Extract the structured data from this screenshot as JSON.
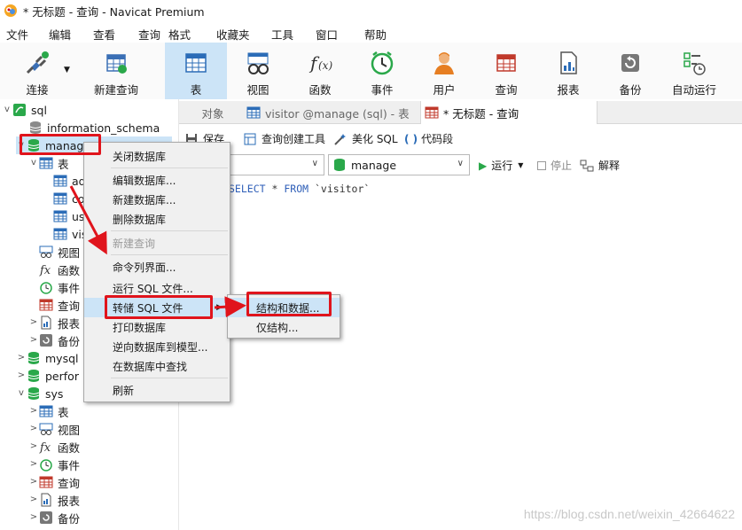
{
  "window": {
    "title": "* 无标题 - 查询 - Navicat Premium"
  },
  "menubar": [
    "文件",
    "编辑",
    "查看",
    "查询",
    "格式",
    "收藏夹",
    "工具",
    "窗口",
    "帮助"
  ],
  "toolbar": {
    "items": [
      {
        "label": "连接",
        "icon": "plug-icon"
      },
      {
        "label": "新建查询",
        "icon": "new-query-icon"
      },
      {
        "label": "表",
        "icon": "table-icon"
      },
      {
        "label": "视图",
        "icon": "view-glasses-icon"
      },
      {
        "label": "函数",
        "icon": "function-icon"
      },
      {
        "label": "事件",
        "icon": "clock-icon"
      },
      {
        "label": "用户",
        "icon": "user-icon"
      },
      {
        "label": "查询",
        "icon": "query-icon"
      },
      {
        "label": "报表",
        "icon": "report-icon"
      },
      {
        "label": "备份",
        "icon": "backup-icon"
      },
      {
        "label": "自动运行",
        "icon": "schedule-icon"
      }
    ]
  },
  "tree": {
    "connection": "sql",
    "info_schema": "information_schema",
    "manage": "manag",
    "manage_table_folder": "表",
    "manage_tables": [
      "ad",
      "co",
      "us",
      "vis"
    ],
    "manage_view": "视图",
    "manage_func": "函数",
    "manage_event": "事件",
    "manage_query": "查询",
    "manage_report": "报表",
    "manage_backup": "备份",
    "mysql": "mysql",
    "perf": "perfor",
    "sys": "sys",
    "sys_items": [
      "表",
      "视图",
      "函数",
      "事件",
      "查询",
      "报表",
      "备份"
    ]
  },
  "tabs": {
    "objects": "对象",
    "visitor": "visitor @manage (sql) - 表",
    "query": "* 无标题 - 查询"
  },
  "querybar": {
    "save": "保存",
    "builder": "查询创建工具",
    "beautify": "美化 SQL",
    "snippet": "代码段",
    "database": "manage",
    "run": "运行",
    "stop": "停止",
    "explain": "解释"
  },
  "editor": {
    "sql_keyword1": "SELECT",
    "sql_star": "*",
    "sql_keyword2": "FROM",
    "sql_table": "`visitor`"
  },
  "context_menu": {
    "items": [
      {
        "label": "关闭数据库",
        "disabled": false
      },
      {
        "label": "编辑数据库...",
        "disabled": false
      },
      {
        "label": "新建数据库...",
        "disabled": false
      },
      {
        "label": "删除数据库",
        "disabled": false
      },
      {
        "label": "新建查询",
        "disabled": true
      },
      {
        "label": "命令列界面...",
        "disabled": false
      },
      {
        "label": "运行 SQL 文件...",
        "disabled": false
      },
      {
        "label": "转储 SQL 文件",
        "disabled": false,
        "highlighted": true
      },
      {
        "label": "打印数据库",
        "disabled": false
      },
      {
        "label": "逆向数据库到模型...",
        "disabled": false
      },
      {
        "label": "在数据库中查找",
        "disabled": false
      },
      {
        "label": "刷新",
        "disabled": false
      }
    ]
  },
  "submenu": {
    "items": [
      "结构和数据...",
      "仅结构..."
    ]
  },
  "watermark": "https://blog.csdn.net/weixin_42664622",
  "colors": {
    "accent": "#cce4f7",
    "annotation": "#e0141c",
    "db_green": "#2aa84a"
  }
}
